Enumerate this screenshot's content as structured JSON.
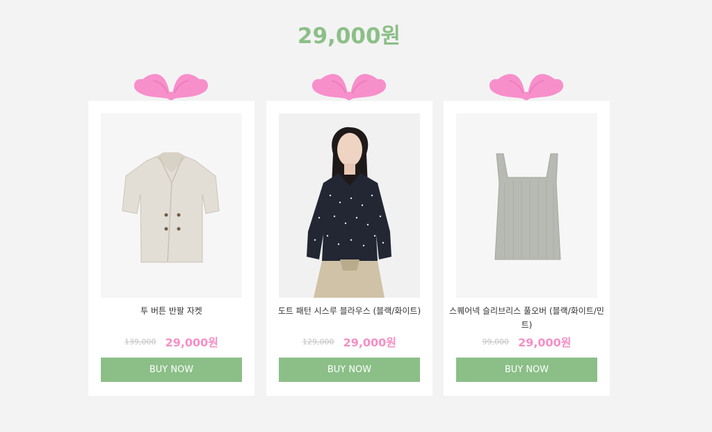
{
  "header": {
    "title": "29,000원"
  },
  "colors": {
    "accent_green": "#8bbf87",
    "sale_pink": "#f58fc5",
    "bow_pink": "#f78fcb"
  },
  "products": [
    {
      "name": "투 버튼 반팔 자켓",
      "original_price": "139,000",
      "sale_price": "29,000원",
      "buy_label": "BUY NOW",
      "image_icon": "beige-short-sleeve-jacket"
    },
    {
      "name": "도트 패턴 시스루 블라우스 (블랙/화이트)",
      "original_price": "129,000",
      "sale_price": "29,000원",
      "buy_label": "BUY NOW",
      "image_icon": "model-in-dot-blouse"
    },
    {
      "name": "스퀘어넥 슬리브리스 풀오버 (블랙/화이트/민트)",
      "original_price": "99,000",
      "sale_price": "29,000원",
      "buy_label": "BUY NOW",
      "image_icon": "grey-sleeveless-top"
    }
  ]
}
